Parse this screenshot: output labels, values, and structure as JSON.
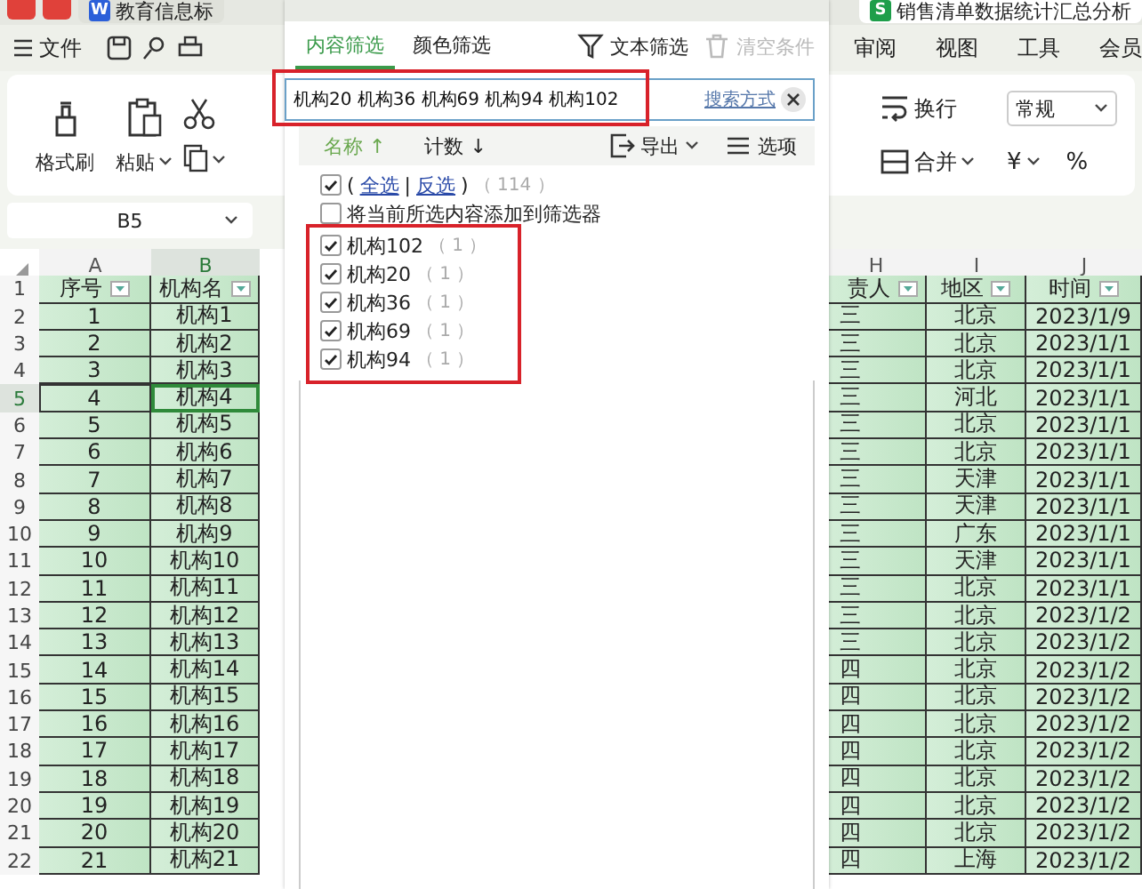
{
  "top_tabs": [
    {
      "label": "教育信息标",
      "logo": "W",
      "selected": false
    },
    {
      "label": "销售清单数据统计汇总分析",
      "logo": "S",
      "selected": true
    }
  ],
  "menu": {
    "file": "文件",
    "items": [
      "审阅",
      "视图",
      "工具",
      "会员"
    ]
  },
  "ribbon": {
    "left_buttons": [
      {
        "label": "格式刷",
        "kind": "brush",
        "dropdown": false
      },
      {
        "label": "粘贴",
        "kind": "clipboard",
        "dropdown": true
      }
    ],
    "right_buttons": [
      {
        "label": "换行",
        "kind": "wrap",
        "dropdown": false
      },
      {
        "label": "合并",
        "kind": "merge",
        "dropdown": true
      }
    ],
    "number_format": {
      "value": "常规"
    },
    "currency": "¥",
    "percent": "%"
  },
  "name_box": {
    "value": "B5"
  },
  "sheet": {
    "header_row_num": "1",
    "columns": [
      {
        "letter": "A",
        "header": "序号",
        "selected": false
      },
      {
        "letter": "B",
        "header": "机构名",
        "selected": true
      },
      {
        "letter": "H",
        "header": "责人",
        "selected": false
      },
      {
        "letter": "I",
        "header": "地区",
        "selected": false
      },
      {
        "letter": "J",
        "header": "时间",
        "selected": false
      }
    ],
    "rows": [
      {
        "num": "2",
        "cells": [
          "1",
          "机构1",
          "三",
          "北京",
          "2023/1/9"
        ],
        "selected": false
      },
      {
        "num": "3",
        "cells": [
          "2",
          "机构2",
          "三",
          "北京",
          "2023/1/1"
        ],
        "selected": false
      },
      {
        "num": "4",
        "cells": [
          "3",
          "机构3",
          "三",
          "北京",
          "2023/1/1"
        ],
        "selected": false
      },
      {
        "num": "5",
        "cells": [
          "4",
          "机构4",
          "三",
          "河北",
          "2023/1/1"
        ],
        "selected": true
      },
      {
        "num": "6",
        "cells": [
          "5",
          "机构5",
          "三",
          "北京",
          "2023/1/1"
        ],
        "selected": false
      },
      {
        "num": "7",
        "cells": [
          "6",
          "机构6",
          "三",
          "北京",
          "2023/1/1"
        ],
        "selected": false
      },
      {
        "num": "8",
        "cells": [
          "7",
          "机构7",
          "三",
          "天津",
          "2023/1/1"
        ],
        "selected": false
      },
      {
        "num": "9",
        "cells": [
          "8",
          "机构8",
          "三",
          "天津",
          "2023/1/1"
        ],
        "selected": false
      },
      {
        "num": "10",
        "cells": [
          "9",
          "机构9",
          "三",
          "广东",
          "2023/1/1"
        ],
        "selected": false
      },
      {
        "num": "11",
        "cells": [
          "10",
          "机构10",
          "三",
          "天津",
          "2023/1/1"
        ],
        "selected": false
      },
      {
        "num": "12",
        "cells": [
          "11",
          "机构11",
          "三",
          "北京",
          "2023/1/1"
        ],
        "selected": false
      },
      {
        "num": "13",
        "cells": [
          "12",
          "机构12",
          "三",
          "北京",
          "2023/1/2"
        ],
        "selected": false
      },
      {
        "num": "14",
        "cells": [
          "13",
          "机构13",
          "三",
          "北京",
          "2023/1/2"
        ],
        "selected": false
      },
      {
        "num": "15",
        "cells": [
          "14",
          "机构14",
          "四",
          "北京",
          "2023/1/2"
        ],
        "selected": false
      },
      {
        "num": "16",
        "cells": [
          "15",
          "机构15",
          "四",
          "北京",
          "2023/1/2"
        ],
        "selected": false
      },
      {
        "num": "17",
        "cells": [
          "16",
          "机构16",
          "四",
          "北京",
          "2023/1/2"
        ],
        "selected": false
      },
      {
        "num": "18",
        "cells": [
          "17",
          "机构17",
          "四",
          "北京",
          "2023/1/2"
        ],
        "selected": false
      },
      {
        "num": "19",
        "cells": [
          "18",
          "机构18",
          "四",
          "北京",
          "2023/1/2"
        ],
        "selected": false
      },
      {
        "num": "20",
        "cells": [
          "19",
          "机构19",
          "四",
          "北京",
          "2023/1/2"
        ],
        "selected": false
      },
      {
        "num": "21",
        "cells": [
          "20",
          "机构20",
          "四",
          "北京",
          "2023/1/2"
        ],
        "selected": false
      },
      {
        "num": "22",
        "cells": [
          "21",
          "机构21",
          "四",
          "上海",
          "2023/1/2"
        ],
        "selected": false
      }
    ]
  },
  "filter": {
    "tabs": [
      {
        "label": "内容筛选",
        "selected": true
      },
      {
        "label": "颜色筛选",
        "selected": false
      }
    ],
    "actions": [
      {
        "label": "文本筛选",
        "kind": "funnel",
        "disabled": false
      },
      {
        "label": "清空条件",
        "kind": "trash",
        "disabled": true
      }
    ],
    "search": {
      "value": "机构20 机构36 机构69 机构94 机构102",
      "link": "搜索方式",
      "highlighted": true
    },
    "sort": [
      {
        "label": "名称",
        "arrow": "↑",
        "active": true
      },
      {
        "label": "计数",
        "arrow": "↓",
        "active": false
      }
    ],
    "tools": [
      {
        "label": "导出",
        "kind": "export",
        "dropdown": true
      },
      {
        "label": "选项",
        "kind": "lines",
        "dropdown": false
      }
    ],
    "select_all": {
      "open": "(",
      "all": "全选",
      "separator": "|",
      "invert": "反选",
      "close": ")",
      "count": "（ 114 ）",
      "checked": true
    },
    "add_to_filter": {
      "label": "将当前所选内容添加到筛选器",
      "checked": false
    },
    "items_highlighted": true,
    "items": [
      {
        "label": "机构102",
        "count": "（ 1 ）",
        "checked": true
      },
      {
        "label": "机构20",
        "count": "（ 1 ）",
        "checked": true
      },
      {
        "label": "机构36",
        "count": "（ 1 ）",
        "checked": true
      },
      {
        "label": "机构69",
        "count": "（ 1 ）",
        "checked": true
      },
      {
        "label": "机构94",
        "count": "（ 1 ）",
        "checked": true
      }
    ]
  }
}
